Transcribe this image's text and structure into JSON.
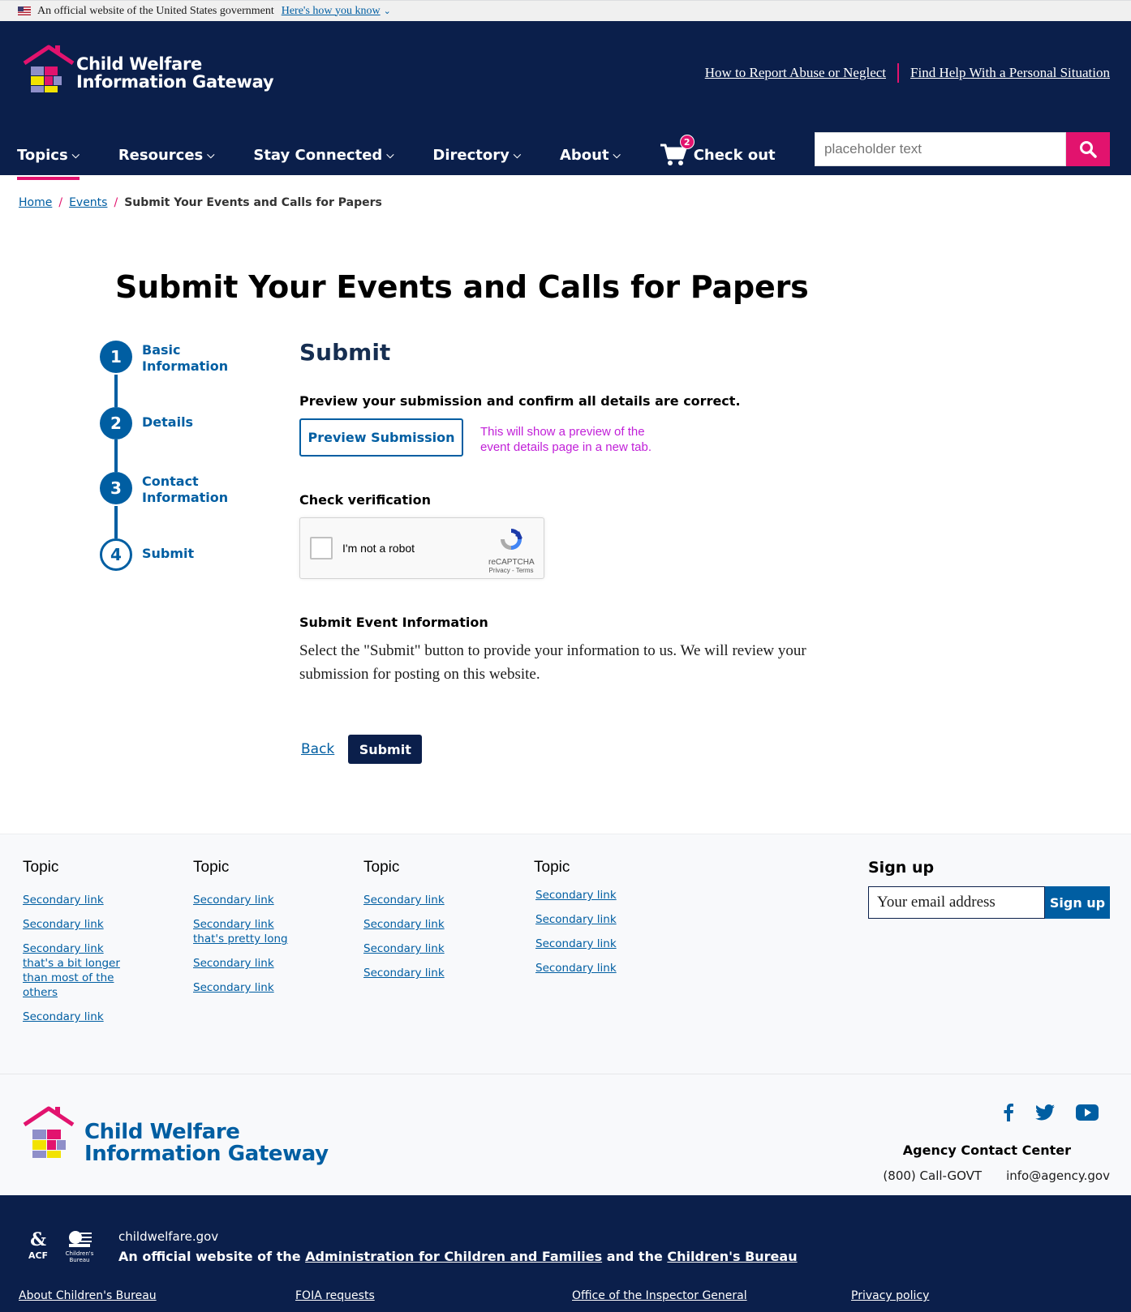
{
  "gov_banner": {
    "text": "An official website of the United States government",
    "how_link": "Here's how you know"
  },
  "header": {
    "logo_line1": "Child Welfare",
    "logo_line2": "Information Gateway",
    "util_links": [
      "How to Report Abuse or Neglect",
      "Find Help With a Personal Situation"
    ],
    "nav": [
      "Topics",
      "Resources",
      "Stay Connected",
      "Directory",
      "About"
    ],
    "cart_label": "Check out",
    "cart_count": "2",
    "search_placeholder": "placeholder text"
  },
  "breadcrumb": {
    "home": "Home",
    "events": "Events",
    "current": "Submit Your Events and Calls for Papers"
  },
  "page_title": "Submit Your Events and Calls for Papers",
  "steps": [
    {
      "number": "1",
      "label": "Basic Information"
    },
    {
      "number": "2",
      "label": "Details"
    },
    {
      "number": "3",
      "label": "Contact Information"
    },
    {
      "number": "4",
      "label": "Submit"
    }
  ],
  "form": {
    "heading": "Submit",
    "preview_lead": "Preview your submission and confirm all details are correct.",
    "preview_button": "Preview Submission",
    "preview_note": "This will show a preview of the event details page in a new tab.",
    "verification_title": "Check verification",
    "captcha_label": "I'm not a robot",
    "captcha_brand": "reCAPTCHA",
    "captcha_terms": "Privacy - Terms",
    "submit_info_title": "Submit Event Information",
    "submit_info_text": "Select the \"Submit\" button to provide your information to us. We will review your submission for posting on this website.",
    "back_link": "Back",
    "submit_button": "Submit"
  },
  "footer": {
    "columns": [
      {
        "title": "Topic",
        "links": [
          "Secondary link",
          "Secondary link",
          "Secondary link that's a bit longer than most of the others",
          "Secondary link"
        ]
      },
      {
        "title": "Topic",
        "links": [
          "Secondary link",
          "Secondary link that's pretty long",
          "Secondary link",
          "Secondary link"
        ]
      },
      {
        "title": "Topic",
        "links": [
          "Secondary link",
          "Secondary link",
          "Secondary link",
          "Secondary link"
        ]
      },
      {
        "title": "Topic",
        "links": [
          "Secondary link",
          "Secondary link",
          "Secondary link",
          "Secondary link"
        ]
      }
    ],
    "signup_title": "Sign up",
    "signup_placeholder": "Your email address",
    "signup_button": "Sign up",
    "logo_line1": "Child Welfare",
    "logo_line2": "Information Gateway",
    "contact_title": "Agency Contact Center",
    "phone": "(800) Call-GOVT",
    "email": "info@agency.gov"
  },
  "identifier": {
    "acf_label": "ACF",
    "cb_label": "Children's Bureau",
    "domain": "childwelfare.gov",
    "desc_prefix": "An official website of the ",
    "desc_link1": "Administration for Children and Families",
    "desc_mid": " and the ",
    "desc_link2": "Children's Bureau",
    "links": [
      "About Children's Bureau",
      "FOIA requests",
      "Office of the Inspector General",
      "Privacy policy"
    ]
  },
  "colors": {
    "navy": "#0b1f4b",
    "primary_blue": "#005ea2",
    "accent_pink": "#e2136e",
    "note_magenta": "#c120d8"
  }
}
